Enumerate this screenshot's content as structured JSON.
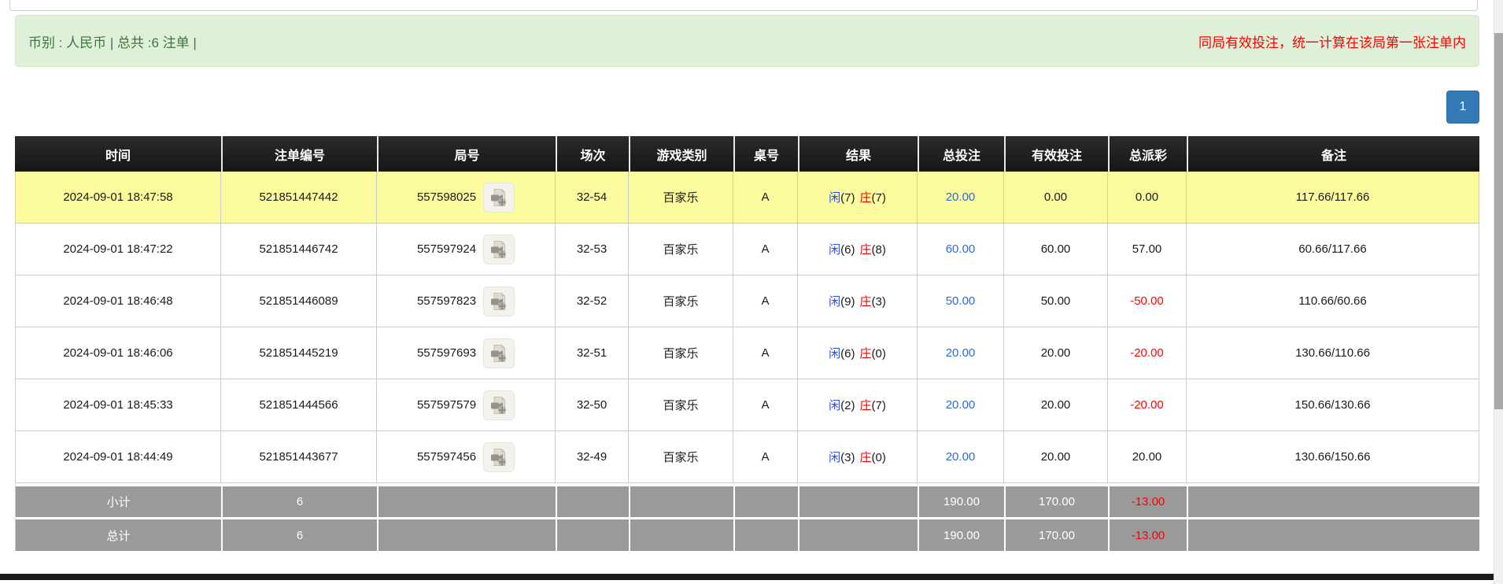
{
  "alert_bar": {
    "summary": "币别 : 人民币 | 总共 :6 注单 |",
    "notice": "同局有效投注，统一计算在该局第一张注单内"
  },
  "pagination": {
    "current_page": "1"
  },
  "icons": {
    "round_action": "video-replay-icon"
  },
  "colors": {
    "alert_bg_green": "#dff0d8",
    "alert_text_green": "#3c763d",
    "notice_red": "#ff0000",
    "accent_blue": "#337ab7",
    "link_blue": "#2a6bd8",
    "player_blue": "#2b50d8",
    "banker_red": "#e60000",
    "negative_red": "#ff0000",
    "highlight_yellow": "#fcfc9e",
    "header_black": "#1b1b1b",
    "footer_gray": "#9a9a9a"
  },
  "table": {
    "headers": {
      "time": "时间",
      "bet_id": "注单编号",
      "round_id": "局号",
      "session": "场次",
      "game_type": "游戏类别",
      "table_no": "桌号",
      "result": "结果",
      "total_bet": "总投注",
      "valid_bet": "有效投注",
      "payout": "总派彩",
      "remark": "备注"
    },
    "rows": [
      {
        "time": "2024-09-01 18:47:58",
        "bet_id": "521851447442",
        "round_id": "557598025",
        "session": "32-54",
        "game_type": "百家乐",
        "table_no": "A",
        "result": {
          "player_label": "闲",
          "player": "(7)",
          "banker_label": "庄",
          "banker": "(7)"
        },
        "total_bet": "20.00",
        "valid_bet": "0.00",
        "payout": "0.00",
        "remark": "117.66/117.66"
      },
      {
        "time": "2024-09-01 18:47:22",
        "bet_id": "521851446742",
        "round_id": "557597924",
        "session": "32-53",
        "game_type": "百家乐",
        "table_no": "A",
        "result": {
          "player_label": "闲",
          "player": "(6)",
          "banker_label": "庄",
          "banker": "(8)"
        },
        "total_bet": "60.00",
        "valid_bet": "60.00",
        "payout": "57.00",
        "remark": "60.66/117.66"
      },
      {
        "time": "2024-09-01 18:46:48",
        "bet_id": "521851446089",
        "round_id": "557597823",
        "session": "32-52",
        "game_type": "百家乐",
        "table_no": "A",
        "result": {
          "player_label": "闲",
          "player": "(9)",
          "banker_label": "庄",
          "banker": "(3)"
        },
        "total_bet": "50.00",
        "valid_bet": "50.00",
        "payout": "-50.00",
        "remark": "110.66/60.66"
      },
      {
        "time": "2024-09-01 18:46:06",
        "bet_id": "521851445219",
        "round_id": "557597693",
        "session": "32-51",
        "game_type": "百家乐",
        "table_no": "A",
        "result": {
          "player_label": "闲",
          "player": "(6)",
          "banker_label": "庄",
          "banker": "(0)"
        },
        "total_bet": "20.00",
        "valid_bet": "20.00",
        "payout": "-20.00",
        "remark": "130.66/110.66"
      },
      {
        "time": "2024-09-01 18:45:33",
        "bet_id": "521851444566",
        "round_id": "557597579",
        "session": "32-50",
        "game_type": "百家乐",
        "table_no": "A",
        "result": {
          "player_label": "闲",
          "player": "(2)",
          "banker_label": "庄",
          "banker": "(7)"
        },
        "total_bet": "20.00",
        "valid_bet": "20.00",
        "payout": "-20.00",
        "remark": "150.66/130.66"
      },
      {
        "time": "2024-09-01 18:44:49",
        "bet_id": "521851443677",
        "round_id": "557597456",
        "session": "32-49",
        "game_type": "百家乐",
        "table_no": "A",
        "result": {
          "player_label": "闲",
          "player": "(3)",
          "banker_label": "庄",
          "banker": "(0)"
        },
        "total_bet": "20.00",
        "valid_bet": "20.00",
        "payout": "20.00",
        "remark": "130.66/150.66"
      }
    ],
    "subtotal": {
      "label": "小计",
      "count": "6",
      "total_bet": "190.00",
      "valid_bet": "170.00",
      "payout": "-13.00"
    },
    "grand_total": {
      "label": "总计",
      "count": "6",
      "total_bet": "190.00",
      "valid_bet": "170.00",
      "payout": "-13.00"
    }
  }
}
